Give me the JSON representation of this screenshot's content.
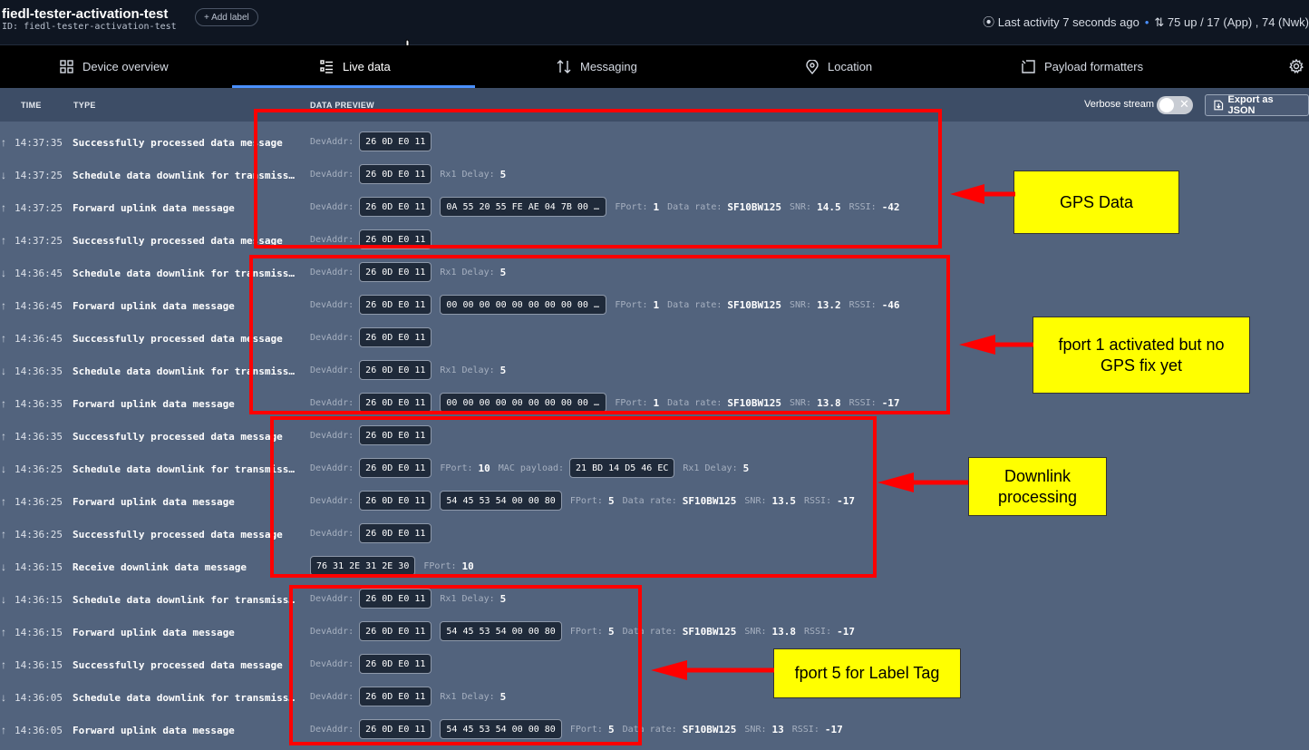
{
  "header": {
    "device_title": "fiedl-tester-activation-test",
    "device_id": "ID: fiedl-tester-activation-test",
    "add_label": "Add label",
    "last_activity": "Last activity 7 seconds ago",
    "traffic": "75 up / 17 (App) , 74 (Nwk)"
  },
  "tabs": [
    {
      "label": "Device overview",
      "icon": "grid-icon"
    },
    {
      "label": "Live data",
      "icon": "list-icon",
      "active": true
    },
    {
      "label": "Messaging",
      "icon": "arrows-updown-icon"
    },
    {
      "label": "Location",
      "icon": "location-pin-icon"
    },
    {
      "label": "Payload formatters",
      "icon": "code-bracket-icon"
    }
  ],
  "table": {
    "col_time": "TIME",
    "col_type": "TYPE",
    "col_preview": "DATA PREVIEW",
    "verbose_label": "Verbose stream",
    "export_label": "Export as JSON"
  },
  "labels": {
    "devaddr": "DevAddr:",
    "rx1": "Rx1 Delay:",
    "fport": "FPort:",
    "datarate": "Data rate:",
    "snr": "SNR:",
    "rssi": "RSSI:",
    "macpayload": "MAC payload:"
  },
  "rows": [
    {
      "dir": "up",
      "time": "14:37:35",
      "type": "Successfully processed data message",
      "devaddr": "26 0D E0 11"
    },
    {
      "dir": "down",
      "time": "14:37:25",
      "type": "Schedule data downlink for transmission",
      "devaddr": "26 0D E0 11",
      "rx1": "5"
    },
    {
      "dir": "up",
      "time": "14:37:25",
      "type": "Forward uplink data message",
      "devaddr": "26 0D E0 11",
      "payload": "0A 55 20 55 FE AE 04 7B 00 02…",
      "fport": "1",
      "datarate": "SF10BW125",
      "snr": "14.5",
      "rssi": "-42"
    },
    {
      "dir": "up",
      "time": "14:37:25",
      "type": "Successfully processed data message",
      "devaddr": "26 0D E0 11"
    },
    {
      "dir": "down",
      "time": "14:36:45",
      "type": "Schedule data downlink for transmission",
      "devaddr": "26 0D E0 11",
      "rx1": "5"
    },
    {
      "dir": "up",
      "time": "14:36:45",
      "type": "Forward uplink data message",
      "devaddr": "26 0D E0 11",
      "payload": "00 00 00 00 00 00 00 00 00 01…",
      "fport": "1",
      "datarate": "SF10BW125",
      "snr": "13.2",
      "rssi": "-46"
    },
    {
      "dir": "up",
      "time": "14:36:45",
      "type": "Successfully processed data message",
      "devaddr": "26 0D E0 11"
    },
    {
      "dir": "down",
      "time": "14:36:35",
      "type": "Schedule data downlink for transmission",
      "devaddr": "26 0D E0 11",
      "rx1": "5"
    },
    {
      "dir": "up",
      "time": "14:36:35",
      "type": "Forward uplink data message",
      "devaddr": "26 0D E0 11",
      "payload": "00 00 00 00 00 00 00 00 00 00…",
      "fport": "1",
      "datarate": "SF10BW125",
      "snr": "13.8",
      "rssi": "-17"
    },
    {
      "dir": "up",
      "time": "14:36:35",
      "type": "Successfully processed data message",
      "devaddr": "26 0D E0 11"
    },
    {
      "dir": "down",
      "time": "14:36:25",
      "type": "Schedule data downlink for transmission",
      "devaddr": "26 0D E0 11",
      "fport": "10",
      "macpayload": "21 BD 14 D5 46 EC",
      "rx1": "5"
    },
    {
      "dir": "up",
      "time": "14:36:25",
      "type": "Forward uplink data message",
      "devaddr": "26 0D E0 11",
      "payload": "54 45 53 54 00 00 80",
      "fport": "5",
      "datarate": "SF10BW125",
      "snr": "13.5",
      "rssi": "-17"
    },
    {
      "dir": "up",
      "time": "14:36:25",
      "type": "Successfully processed data message",
      "devaddr": "26 0D E0 11"
    },
    {
      "dir": "down",
      "time": "14:36:15",
      "type": "Receive downlink data message",
      "downpayload": "76 31 2E 31 2E 30",
      "fport": "10"
    },
    {
      "dir": "down",
      "time": "14:36:15",
      "type": "Schedule data downlink for transmission",
      "devaddr": "26 0D E0 11",
      "rx1": "5"
    },
    {
      "dir": "up",
      "time": "14:36:15",
      "type": "Forward uplink data message",
      "devaddr": "26 0D E0 11",
      "payload": "54 45 53 54 00 00 80",
      "fport": "5",
      "datarate": "SF10BW125",
      "snr": "13.8",
      "rssi": "-17"
    },
    {
      "dir": "up",
      "time": "14:36:15",
      "type": "Successfully processed data message",
      "devaddr": "26 0D E0 11"
    },
    {
      "dir": "down",
      "time": "14:36:05",
      "type": "Schedule data downlink for transmission",
      "devaddr": "26 0D E0 11",
      "rx1": "5"
    },
    {
      "dir": "up",
      "time": "14:36:05",
      "type": "Forward uplink data message",
      "devaddr": "26 0D E0 11",
      "payload": "54 45 53 54 00 00 80",
      "fport": "5",
      "datarate": "SF10BW125",
      "snr": "13",
      "rssi": "-17"
    }
  ],
  "annotations": {
    "gps": "GPS Data",
    "fport1": "fport 1 activated but no GPS fix yet",
    "downlink": "Downlink processing",
    "fport5": "fport 5 for Label Tag"
  },
  "colors": {
    "background": "#52637d",
    "header": "#0f1622",
    "accent": "#4a90ff",
    "annotation_box": "#ff0000",
    "callout": "#ffff00"
  }
}
